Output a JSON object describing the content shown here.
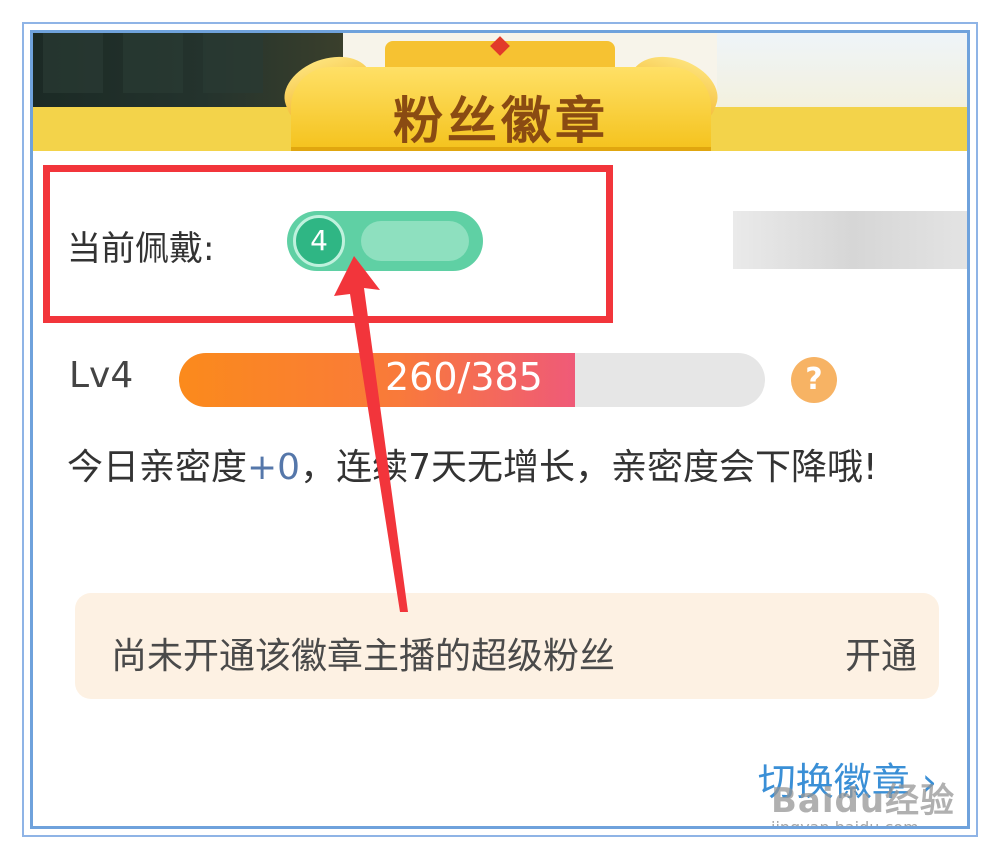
{
  "header": {
    "title": "粉丝徽章"
  },
  "current": {
    "label": "当前佩戴:",
    "badge_level": "4"
  },
  "level": {
    "label": "Lv4",
    "progress_text": "260/385",
    "progress_fraction": 0.675
  },
  "notice": {
    "part1": "今日亲密度",
    "plus": "+0",
    "part2": "，连续7天无增长，亲密度会下降哦!"
  },
  "super_fan": {
    "text": "尚未开通该徽章主播的超级粉丝",
    "action": "开通"
  },
  "switch_badge": {
    "label": "切换徽章",
    "chevron": "›"
  },
  "watermark": {
    "main": "Baidu经验",
    "sub": "jingyan.baidu.com"
  },
  "colors": {
    "accent_red": "#f2353b",
    "badge_green": "#5fd0a4",
    "progress_orange": "#fb8a1c",
    "link_blue": "#3a8fd6"
  }
}
